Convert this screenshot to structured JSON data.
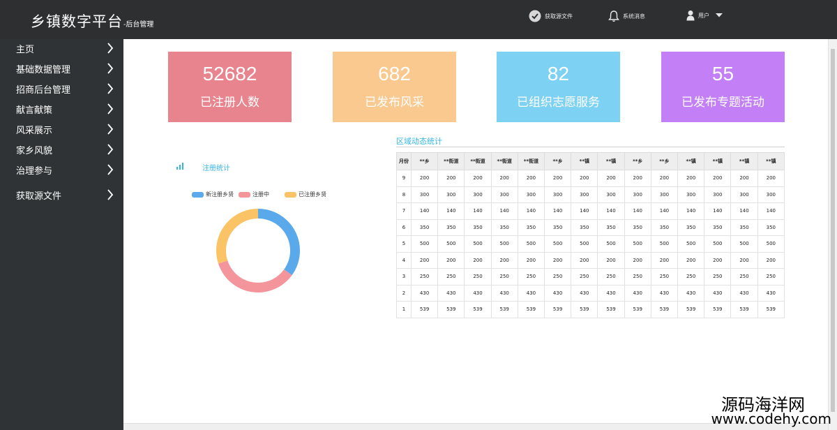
{
  "header": {
    "title": "乡镇数字平台",
    "subtitle": "-后台管理",
    "get_source_label": "获取源文件",
    "messages_label": "系统消息",
    "user_label": "用户"
  },
  "sidebar": {
    "items": [
      {
        "label": "主页"
      },
      {
        "label": "基础数据管理"
      },
      {
        "label": "招商后台管理"
      },
      {
        "label": "献言献策"
      },
      {
        "label": "风采展示"
      },
      {
        "label": "家乡风貌"
      },
      {
        "label": "治理参与"
      },
      {
        "label": "获取源文件"
      }
    ]
  },
  "stats": [
    {
      "value": "52682",
      "label": "已注册人数",
      "color": "#e8848e"
    },
    {
      "value": "682",
      "label": "已发布风采",
      "color": "#f9c98f"
    },
    {
      "value": "82",
      "label": "已组织志愿服务",
      "color": "#7dd1f2"
    },
    {
      "value": "55",
      "label": "已发布专题活动",
      "color": "#c37ff5"
    }
  ],
  "registration": {
    "title": "注册统计",
    "legend": [
      {
        "name": "新注册乡贤",
        "color": "#5aa9ea"
      },
      {
        "name": "注册中",
        "color": "#f4959b"
      },
      {
        "name": "已注册乡贤",
        "color": "#fac366"
      }
    ]
  },
  "chart_data": {
    "type": "pie",
    "donut": true,
    "series": [
      {
        "name": "新注册乡贤",
        "value": 35
      },
      {
        "name": "注册中",
        "value": 35
      },
      {
        "name": "已注册乡贤",
        "value": 30
      }
    ]
  },
  "table": {
    "title": "区域动态统计",
    "headers": [
      "月份",
      "**乡",
      "**街道",
      "**街道",
      "**街道",
      "**街道",
      "**乡",
      "**镇",
      "**镇",
      "**乡",
      "**乡",
      "**镇",
      "**镇",
      "**镇",
      "**镇"
    ],
    "rows": [
      [
        "9",
        "200",
        "200",
        "200",
        "200",
        "200",
        "200",
        "200",
        "200",
        "200",
        "200",
        "200",
        "200",
        "200",
        "200"
      ],
      [
        "8",
        "300",
        "300",
        "300",
        "300",
        "300",
        "300",
        "300",
        "300",
        "300",
        "300",
        "300",
        "300",
        "300",
        "300"
      ],
      [
        "7",
        "140",
        "140",
        "140",
        "140",
        "140",
        "140",
        "140",
        "140",
        "140",
        "140",
        "140",
        "140",
        "140",
        "140"
      ],
      [
        "6",
        "350",
        "350",
        "350",
        "350",
        "350",
        "350",
        "350",
        "350",
        "350",
        "350",
        "350",
        "350",
        "350",
        "350"
      ],
      [
        "5",
        "500",
        "500",
        "500",
        "500",
        "500",
        "500",
        "500",
        "500",
        "500",
        "500",
        "500",
        "500",
        "500",
        "500"
      ],
      [
        "4",
        "200",
        "200",
        "200",
        "200",
        "200",
        "200",
        "200",
        "200",
        "200",
        "200",
        "200",
        "200",
        "200",
        "200"
      ],
      [
        "3",
        "250",
        "250",
        "250",
        "250",
        "250",
        "250",
        "250",
        "250",
        "250",
        "250",
        "250",
        "250",
        "250",
        "250"
      ],
      [
        "2",
        "430",
        "430",
        "430",
        "430",
        "430",
        "430",
        "430",
        "430",
        "430",
        "430",
        "430",
        "430",
        "430",
        "430"
      ],
      [
        "1",
        "539",
        "539",
        "539",
        "539",
        "539",
        "539",
        "539",
        "539",
        "539",
        "539",
        "539",
        "539",
        "539",
        "539"
      ]
    ]
  },
  "watermark": {
    "name": "源码海洋网",
    "url": "www.codehy.com"
  }
}
